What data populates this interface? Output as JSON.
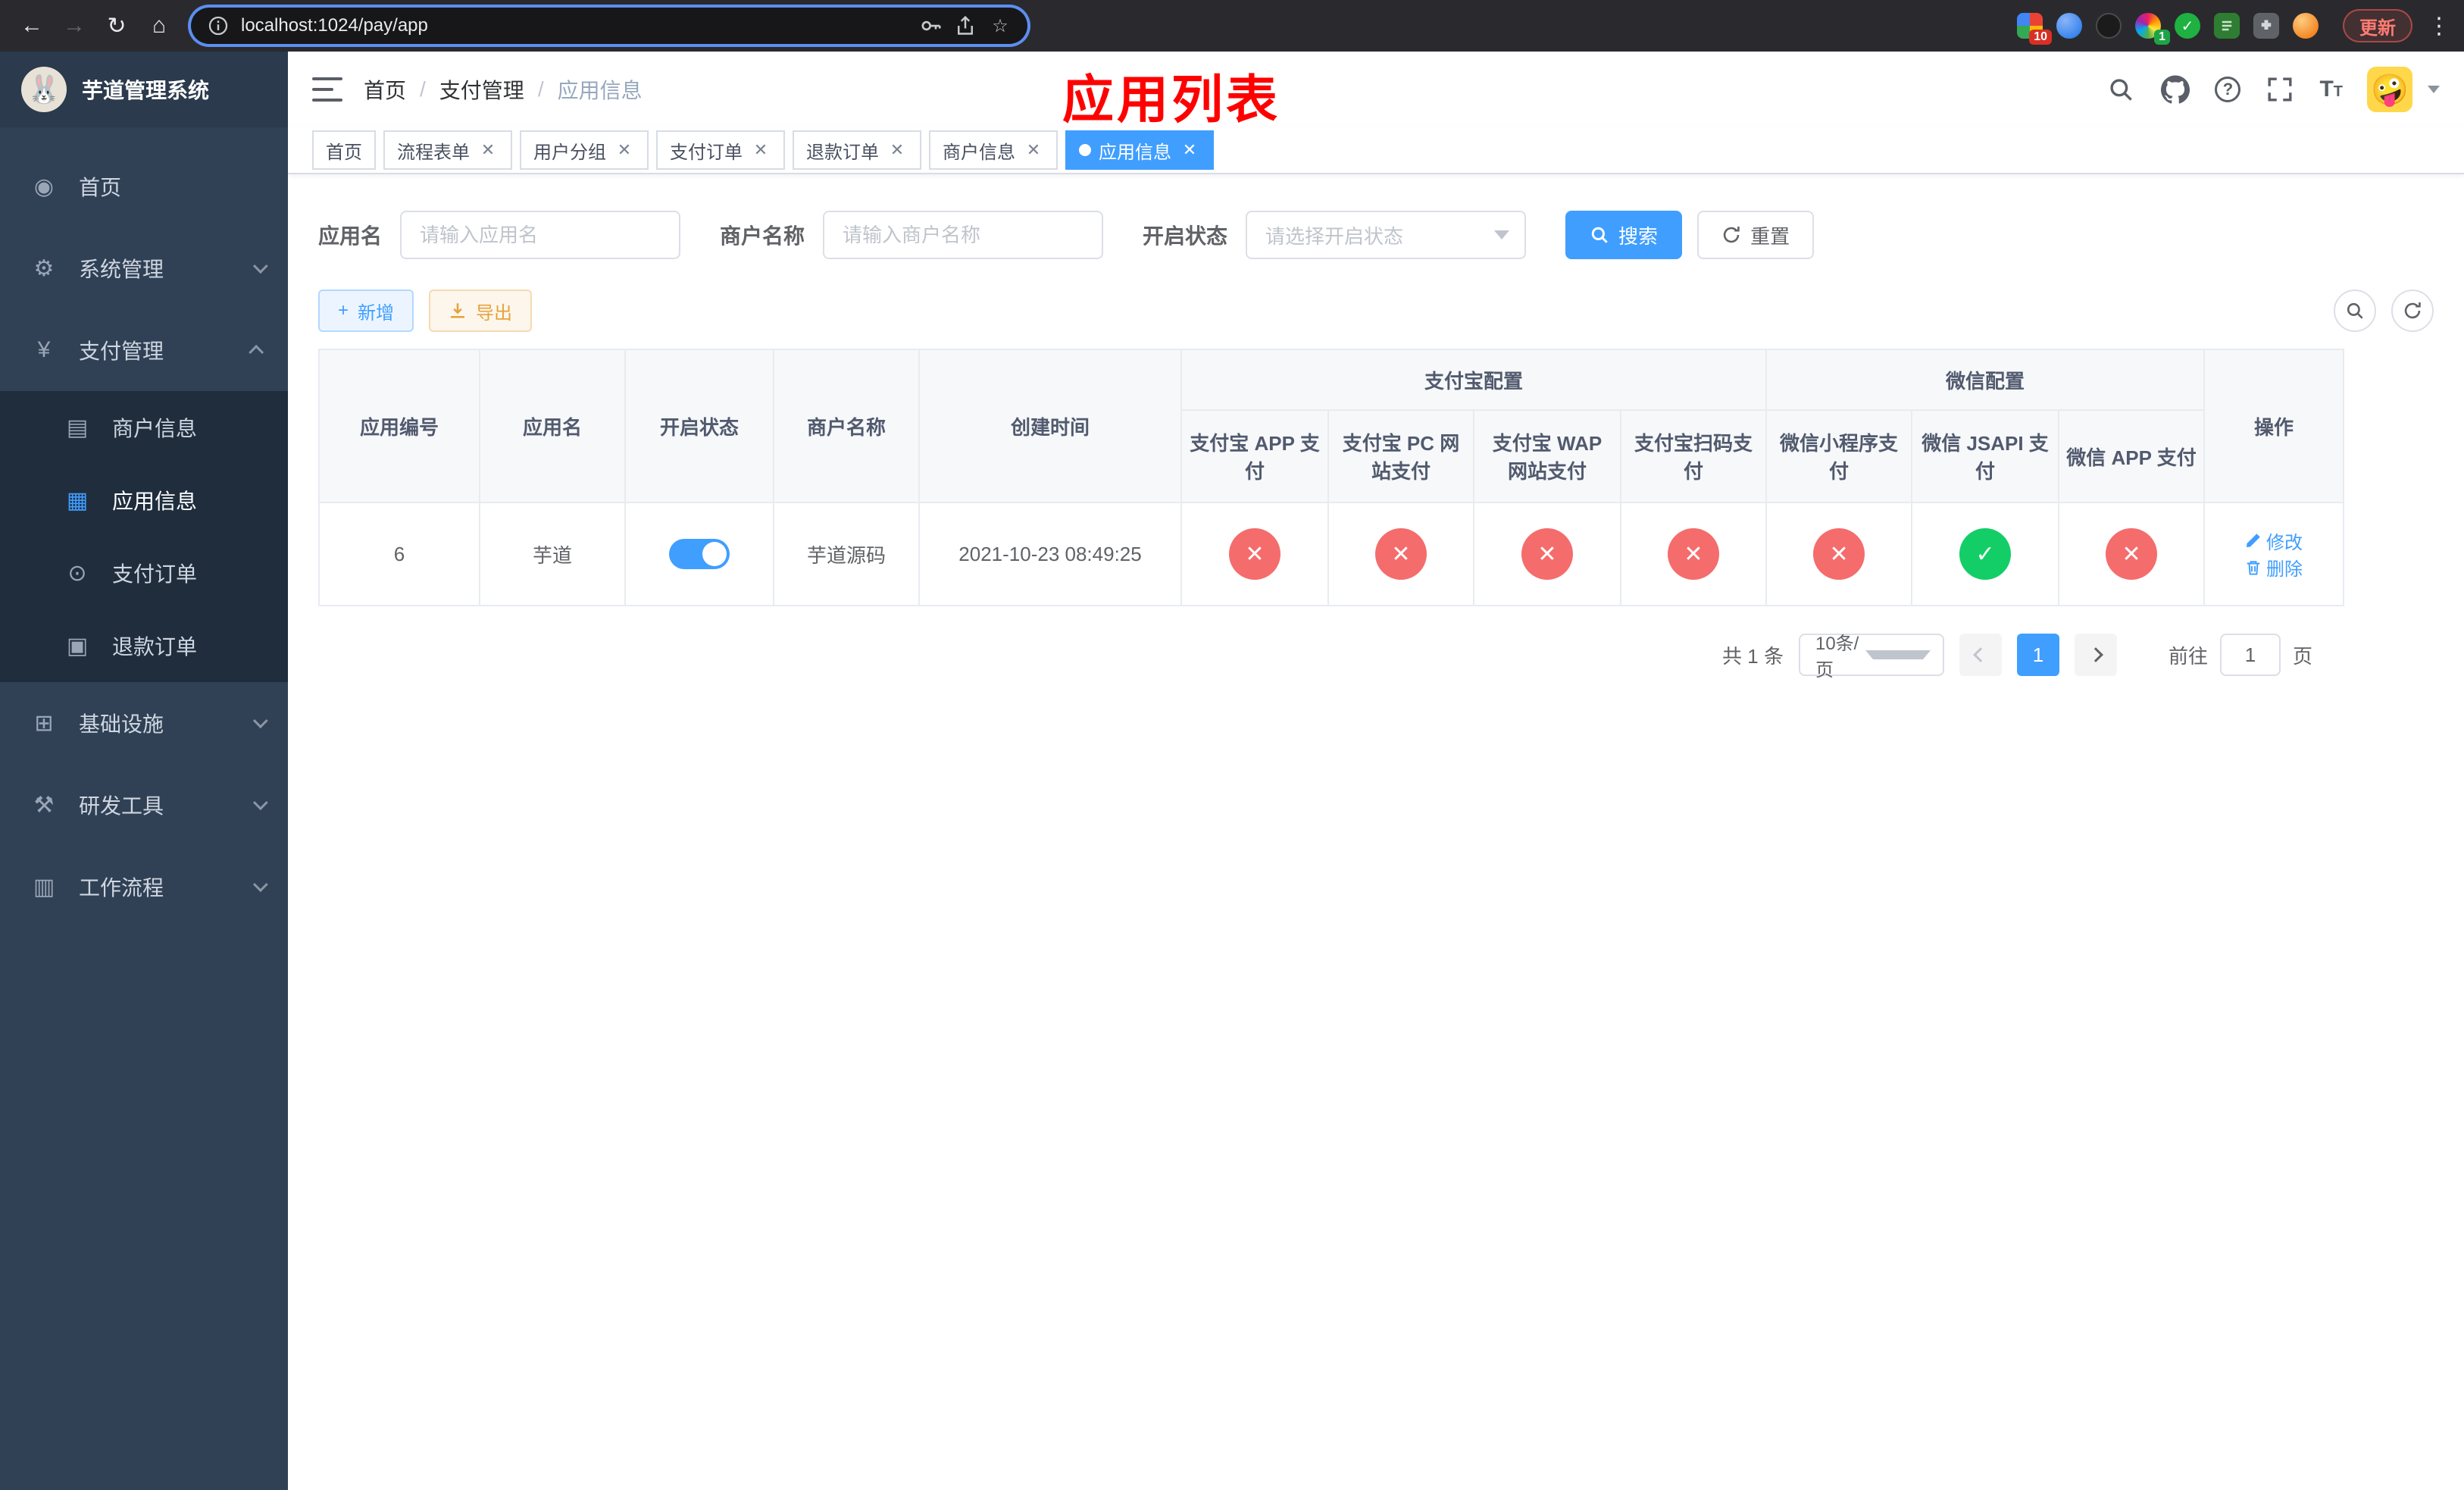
{
  "colors": {
    "primary": "#409eff",
    "danger_circle": "#f56c6c",
    "success_circle": "#13ce66",
    "warning": "#e6a23c",
    "annotation_red": "#ff0000",
    "sidebar_bg": "#304156",
    "submenu_bg": "#1f2d3d",
    "chrome_bg": "#2a2a2e"
  },
  "icons": {
    "back": "←",
    "forward": "→",
    "reload": "↻",
    "home": "⌂",
    "star": "☆",
    "dots": "⋮",
    "dashboard": "◉",
    "gear": "⚙",
    "yen": "¥",
    "card": "▤",
    "grid": "▦",
    "order": "⊙",
    "doc": "▣",
    "infra": "⊞",
    "tools": "⚒",
    "flow": "▥",
    "plus": "+",
    "download": "↓",
    "refresh": "↻",
    "question": "?",
    "check_badge": "✓",
    "avatar_emoji": "🤪",
    "logo_emoji": "🐰",
    "text_size_big": "T",
    "text_size_small": "T"
  },
  "browser": {
    "url": "localhost:1024/pay/app",
    "update_label": "更新",
    "ext_badge_red": "10",
    "ext_badge_green": "1"
  },
  "sidebar": {
    "title": "芋道管理系统",
    "items": [
      {
        "label": "首页"
      },
      {
        "label": "系统管理"
      },
      {
        "label": "支付管理"
      },
      {
        "label": "商户信息"
      },
      {
        "label": "应用信息"
      },
      {
        "label": "支付订单"
      },
      {
        "label": "退款订单"
      },
      {
        "label": "基础设施"
      },
      {
        "label": "研发工具"
      },
      {
        "label": "工作流程"
      }
    ]
  },
  "header": {
    "breadcrumb": [
      "首页",
      "支付管理",
      "应用信息"
    ],
    "annotation": "应用列表"
  },
  "tabs": [
    {
      "label": "首页",
      "closable": false,
      "active": false
    },
    {
      "label": "流程表单",
      "closable": true,
      "active": false
    },
    {
      "label": "用户分组",
      "closable": true,
      "active": false
    },
    {
      "label": "支付订单",
      "closable": true,
      "active": false
    },
    {
      "label": "退款订单",
      "closable": true,
      "active": false
    },
    {
      "label": "商户信息",
      "closable": true,
      "active": false
    },
    {
      "label": "应用信息",
      "closable": true,
      "active": true
    }
  ],
  "filters": {
    "app_name_label": "应用名",
    "app_name_placeholder": "请输入应用名",
    "merchant_label": "商户名称",
    "merchant_placeholder": "请输入商户名称",
    "status_label": "开启状态",
    "status_placeholder": "请选择开启状态",
    "search_label": "搜索",
    "reset_label": "重置"
  },
  "toolbar": {
    "add_label": "新增",
    "export_label": "导出"
  },
  "table": {
    "group_headers": {
      "alipay": "支付宝配置",
      "wechat": "微信配置"
    },
    "columns": [
      "应用编号",
      "应用名",
      "开启状态",
      "商户名称",
      "创建时间",
      "支付宝 APP 支付",
      "支付宝 PC 网站支付",
      "支付宝 WAP 网站支付",
      "支付宝扫码支付",
      "微信小程序支付",
      "微信 JSAPI 支付",
      "微信 APP 支付",
      "操作"
    ],
    "status_glyphs": {
      "yes": "✓",
      "no": "✕"
    },
    "rows": [
      {
        "id": "6",
        "name": "芋道",
        "enabled": true,
        "merchant": "芋道源码",
        "created": "2021-10-23 08:49:25",
        "alipay_app": false,
        "alipay_pc": false,
        "alipay_wap": false,
        "alipay_qr": false,
        "wx_mini": false,
        "wx_jsapi": true,
        "wx_app": false,
        "edit_label": "修改",
        "delete_label": "删除"
      }
    ]
  },
  "pagination": {
    "total": "共 1 条",
    "page_size": "10条/页",
    "current_page": "1",
    "goto_label": "前往",
    "goto_value": "1",
    "page_label": "页"
  }
}
